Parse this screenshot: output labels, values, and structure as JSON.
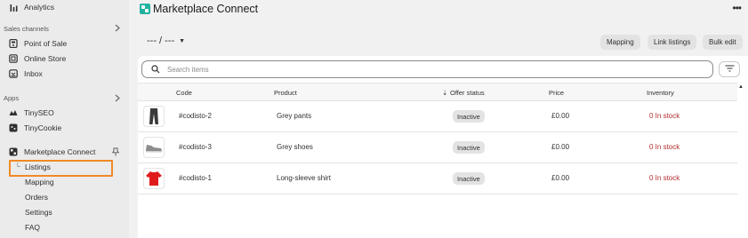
{
  "sidebar": {
    "analytics": "Analytics",
    "sales_channels_header": "Sales channels",
    "sales_channels": [
      {
        "label": "Point of Sale",
        "icon": "point-of-sale-icon"
      },
      {
        "label": "Online Store",
        "icon": "online-store-icon"
      },
      {
        "label": "Inbox",
        "icon": "inbox-icon"
      }
    ],
    "apps_header": "Apps",
    "apps": [
      {
        "label": "TinySEO",
        "icon": "tinyseo-icon"
      },
      {
        "label": "TinyCookie",
        "icon": "tinycookie-icon"
      }
    ],
    "marketplace_connect": "Marketplace Connect",
    "sub_items": [
      "Listings",
      "Mapping",
      "Orders",
      "Settings",
      "FAQ"
    ],
    "selected_item": "Listings"
  },
  "header": {
    "title": "Marketplace Connect",
    "more_icon": "more-horizontal-icon"
  },
  "toolbar": {
    "period_label": "--- / ---",
    "mapping_label": "Mapping",
    "link_listings_label": "Link listings",
    "bulk_edit_label": "Bulk edit"
  },
  "search": {
    "placeholder": "Search items",
    "value": ""
  },
  "table": {
    "columns": {
      "code": "Code",
      "product": "Product",
      "offer_status": "Offer status",
      "price": "Price",
      "inventory": "Inventory"
    },
    "rows": [
      {
        "code": "#codisto-2",
        "product": "Grey pants",
        "status": "Inactive",
        "price": "£0.00",
        "inventory": "0 In stock",
        "thumb": "grey-pants-thumbnail"
      },
      {
        "code": "#codisto-3",
        "product": "Grey shoes",
        "status": "Inactive",
        "price": "£0.00",
        "inventory": "0 In stock",
        "thumb": "grey-shoes-thumbnail"
      },
      {
        "code": "#codisto-1",
        "product": "Long-sleeve shirt",
        "status": "Inactive",
        "price": "£0.00",
        "inventory": "0 In stock",
        "thumb": "red-shirt-thumbnail"
      }
    ]
  },
  "colors": {
    "selected_outline": "#f08a24",
    "stock_text": "#b32d2e",
    "app_icon": "#21b3a0"
  }
}
